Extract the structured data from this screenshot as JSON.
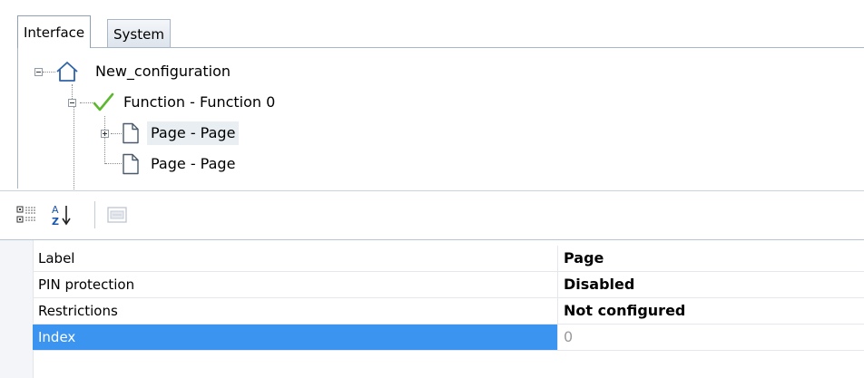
{
  "tabs": [
    {
      "label": "Interface",
      "active": true
    },
    {
      "label": "System",
      "active": false
    }
  ],
  "tree": {
    "root": {
      "label": "New_configuration",
      "icon": "house-icon",
      "expanded": true
    },
    "function": {
      "label": "Function - Function 0",
      "icon": "checkmark-icon",
      "expanded": true
    },
    "page1": {
      "label": "Page - Page",
      "icon": "page-icon",
      "expanded": false,
      "selected": true
    },
    "page2": {
      "label": "Page - Page",
      "icon": "page-icon"
    }
  },
  "toolbar": {
    "categorized_icon": "categorized-list-icon",
    "sort_icon": "sort-az-icon",
    "property_pages_icon": "property-pages-icon"
  },
  "properties": [
    {
      "name": "Label",
      "value": "Page"
    },
    {
      "name": "PIN protection",
      "value": "Disabled"
    },
    {
      "name": "Restrictions",
      "value": "Not configured"
    },
    {
      "name": "Index",
      "value": "0",
      "selected": true
    }
  ],
  "colors": {
    "selection_blue": "#3b95f0",
    "check_green": "#5cb82e",
    "tree_line": "#8c8c8c"
  }
}
